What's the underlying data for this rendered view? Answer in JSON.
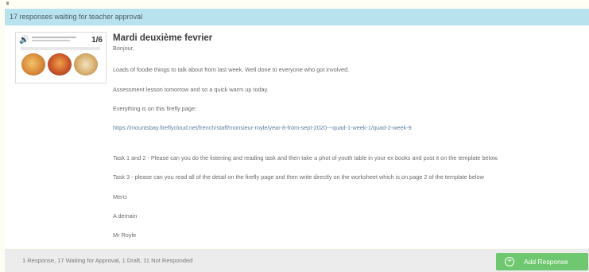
{
  "banner": {
    "text": "17 responses waiting for teacher approval"
  },
  "post": {
    "title": "Mardi deuxième fevrier",
    "thumbnail": {
      "counter": "1/6",
      "icon": "speaker-icon"
    },
    "paragraphs": [
      "Bonjour,",
      "Loads of foodie things to talk about from last week. Well done to everyone who got involved.",
      "Assessment lesson tomorrow and so a quick warm up today.",
      "Everything is on this firefly page:",
      "https://mountsbay.fireflycloud.net/french/staff/monsieur-royle/year-8-from-sept-2020---quad-1-week-1/quad-2-week-9",
      "Task 1 and 2 - Please can you do the listening and reading task and then take a phot of youth table in your ex books and post it on the template below.",
      "Task 3 - please can you read all of the detail on the firefly page and then write directly on the worksheet which is on page 2 of the template below",
      "Merci",
      "A demain",
      "Mr Royle"
    ]
  },
  "footer": {
    "status": "1 Response, 17 Waiting for Approval, 1 Draft, 11 Not Responded",
    "add_label": "Add Response"
  },
  "colors": {
    "banner": "#b9e2ef",
    "add_button": "#6fc86f",
    "link": "#5b7fa6"
  }
}
